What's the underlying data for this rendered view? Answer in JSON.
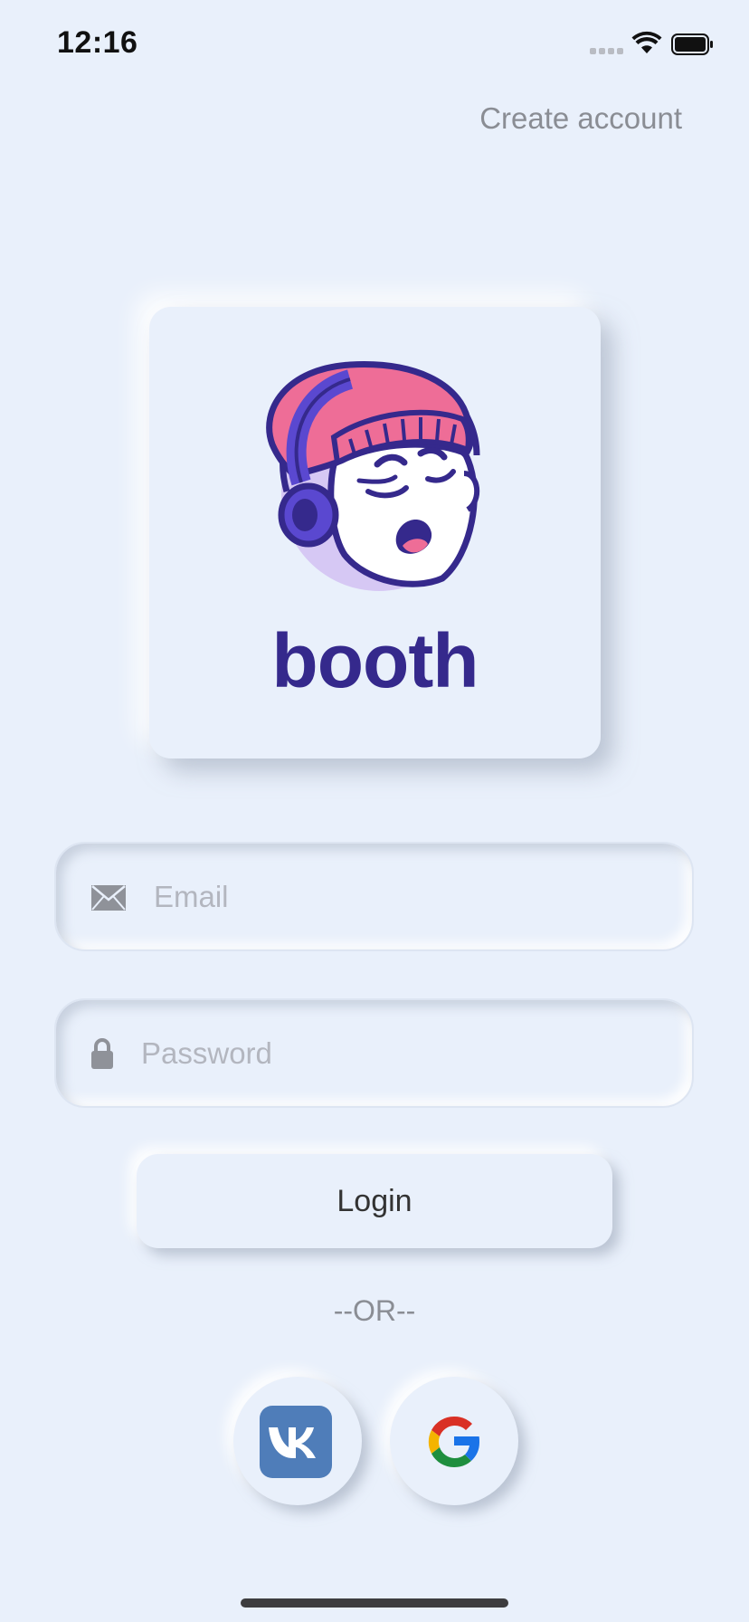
{
  "status_bar": {
    "time": "12:16"
  },
  "header": {
    "create_account_label": "Create account"
  },
  "logo": {
    "brand_name": "booth"
  },
  "form": {
    "email_placeholder": "Email",
    "email_value": "",
    "password_placeholder": "Password",
    "password_value": "",
    "login_label": "Login"
  },
  "divider": {
    "or_label": "--OR--"
  },
  "social": {
    "vk_icon": "vk-icon",
    "google_icon": "google-icon"
  },
  "colors": {
    "background": "#e9f0fb",
    "brand_purple": "#35298c",
    "hat_pink": "#ee6d97",
    "vk_blue": "#4f7db9",
    "muted_text": "#8a8d94"
  }
}
